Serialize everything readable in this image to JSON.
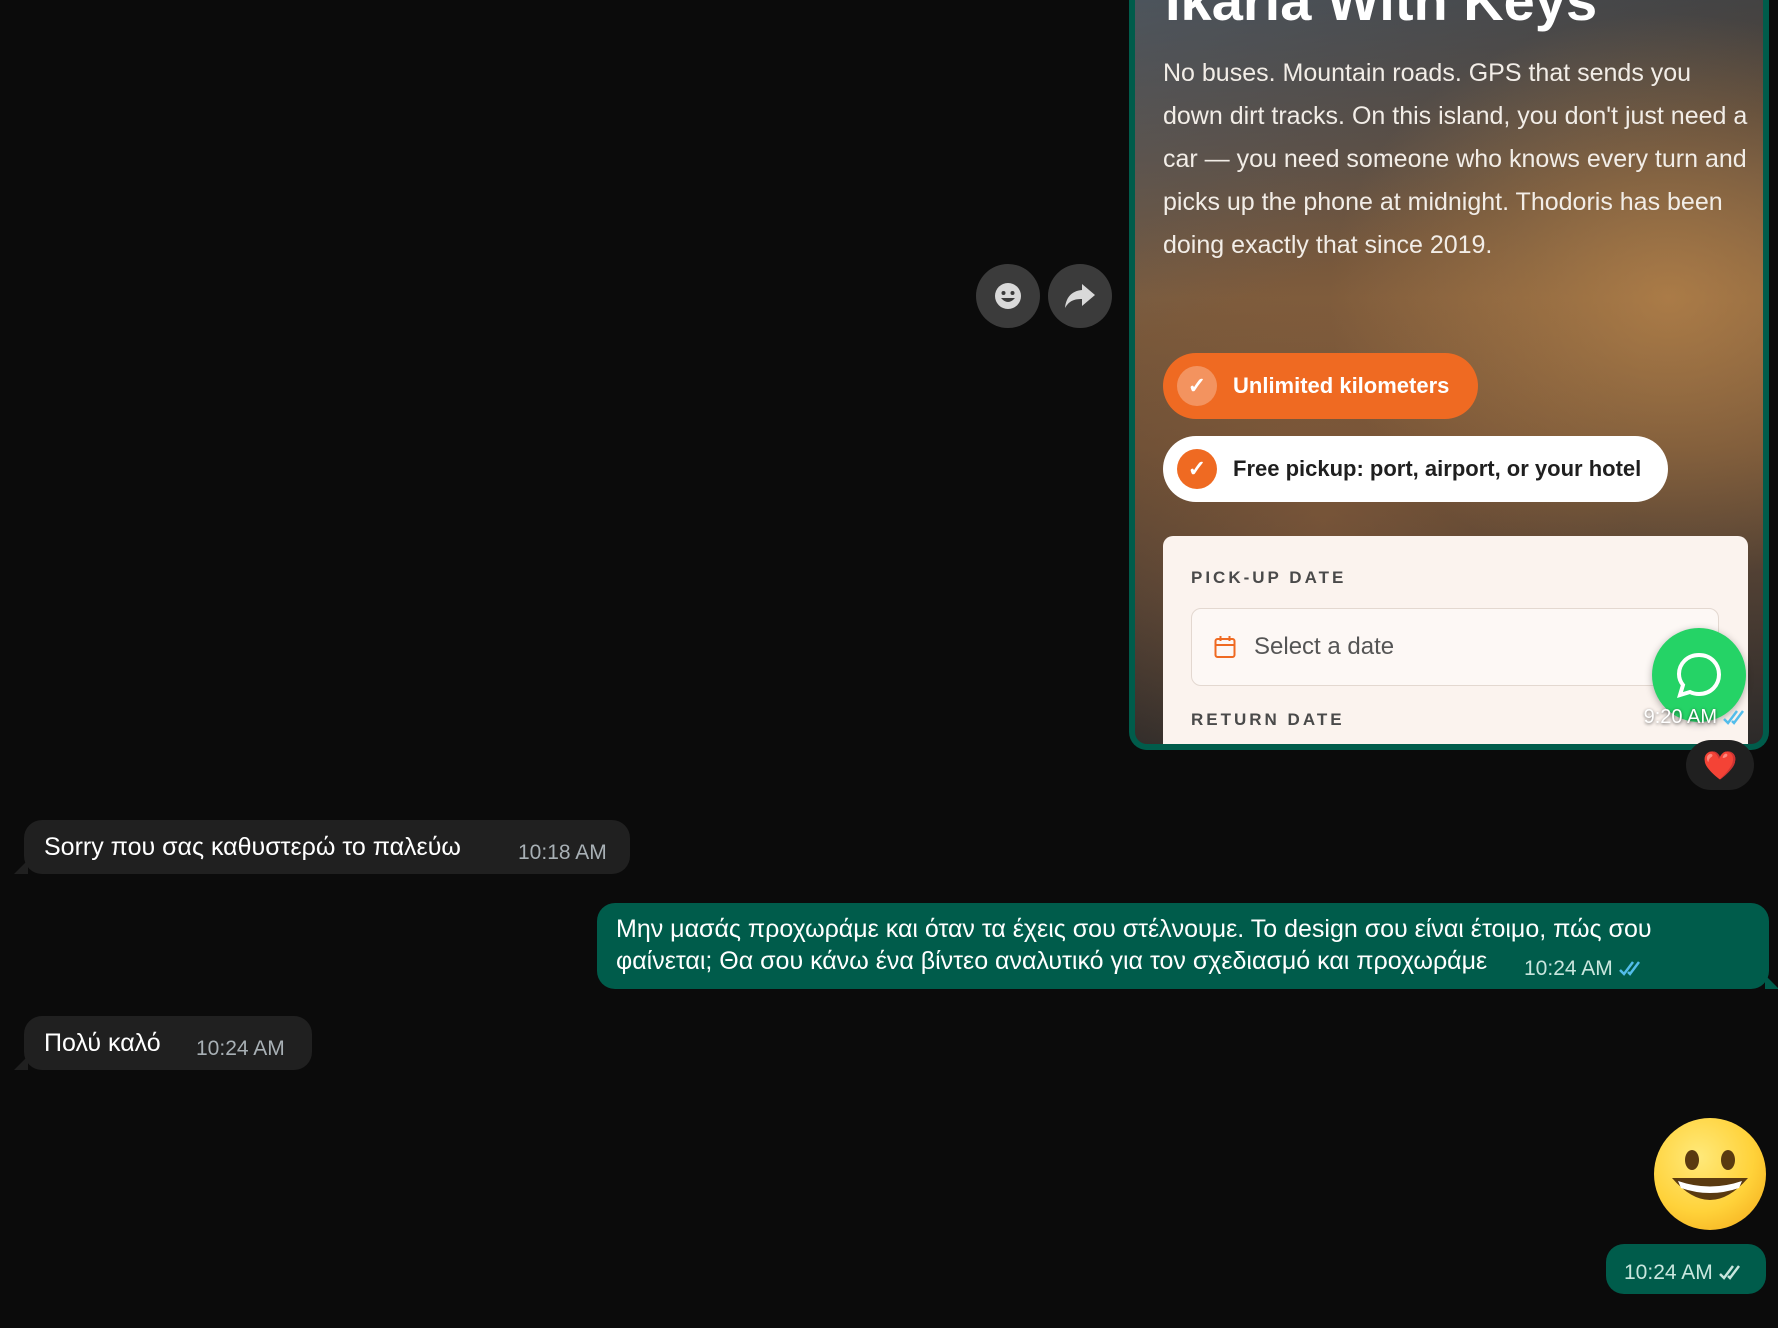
{
  "image_message": {
    "title": "Ikaria With Keys",
    "description": "No buses. Mountain roads. GPS that sends you down dirt tracks. On this island, you don't just need a car — you need someone who knows every turn and picks up the phone at midnight. Thodoris has been doing exactly that since 2019.",
    "chip_1": "Unlimited kilometers",
    "chip_2": "Free pickup: port, airport, or your hotel",
    "pickup_label": "PICK-UP DATE",
    "pickup_placeholder": "Select a date",
    "return_label": "RETURN DATE",
    "time": "9:20 AM",
    "reaction": "❤️"
  },
  "messages": [
    {
      "text": "Sorry που σας καθυστερώ το παλεύω",
      "time": "10:18 AM"
    },
    {
      "line1": "Μην μασάς προχωράμε και όταν τα έχεις σου στέλνουμε. Το design σου είναι έτοιμο, πώς σου",
      "line2": "φαίνεται; Θα σου κάνω ένα βίντεο αναλυτικό για τον σχεδιασμό και προχωράμε",
      "time": "10:24 AM"
    },
    {
      "text": "Πολύ καλό",
      "time": "10:24 AM"
    },
    {
      "emoji": "grinning-face",
      "time": "10:24 AM"
    }
  ],
  "colors": {
    "background": "#0b0b0b",
    "incoming_bubble": "#202020",
    "outgoing_bubble": "#005c4b",
    "accent_orange": "#ef6a22",
    "read_ticks": "#53bdeb"
  }
}
